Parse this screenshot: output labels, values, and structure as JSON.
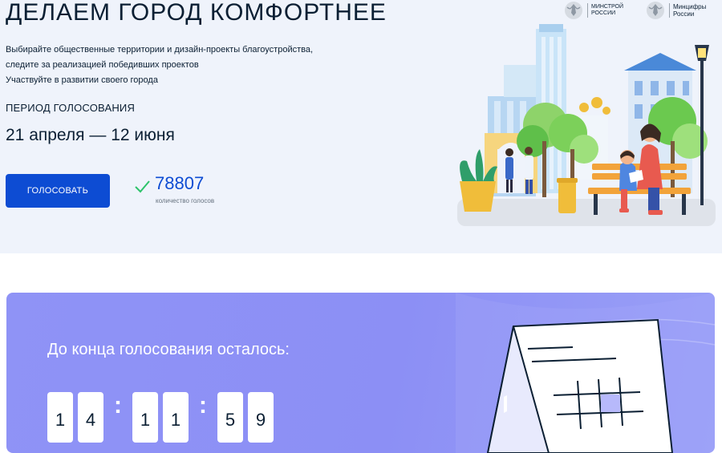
{
  "hero": {
    "title": "ДЕЛАЕМ ГОРОД КОМФОРТНЕЕ",
    "description_lines": [
      "Выбирайте общественные территории и дизайн-проекты благоустройства,",
      "следите за реализацией победивших проектов",
      "Участвуйте в развитии своего города"
    ],
    "period_label": "ПЕРИОД ГОЛОСОВАНИЯ",
    "period_dates": "21 апреля — 12 июня",
    "vote_button_label": "ГОЛОСОВАТЬ",
    "votes_count": "78807",
    "votes_label": "количество голосов"
  },
  "logos": {
    "minstroy": "МИНСТРОЙ\nРОССИИ",
    "mincifry": "Минцифры\nРоссии"
  },
  "timer": {
    "title": "До конца голосования осталось:",
    "digits": [
      "1",
      "4",
      "1",
      "1",
      "5",
      "9"
    ],
    "separator": ":"
  },
  "colors": {
    "accent": "#0d4cd3",
    "hero_bg": "#eff3fb",
    "timer_bg": "#8f93f6",
    "check": "#2dc36a"
  },
  "icons": {
    "check": "check-icon",
    "seal": "coat-of-arms-icon"
  }
}
